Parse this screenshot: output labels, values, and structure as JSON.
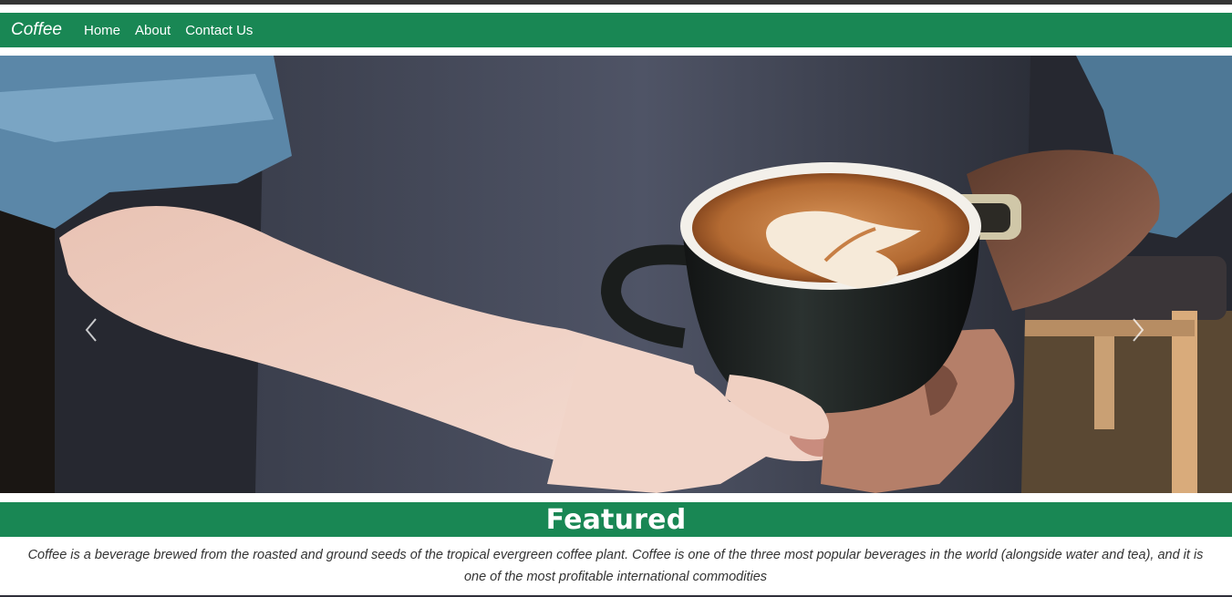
{
  "navbar": {
    "brand": "Coffee",
    "links": [
      "Home",
      "About",
      "Contact Us"
    ]
  },
  "carousel": {
    "slide_count": 3,
    "active_index": 2,
    "image_subject": "hands holding latte art coffee cup"
  },
  "featured": {
    "title": "Featured",
    "description": "Coffee is a beverage brewed from the roasted and ground seeds of the tropical evergreen coffee plant. Coffee is one of the three most popular beverages in the world (alongside water and tea), and it is one of the most profitable international commodities"
  },
  "colors": {
    "brand_green": "#198754",
    "text_dark": "#333333"
  }
}
